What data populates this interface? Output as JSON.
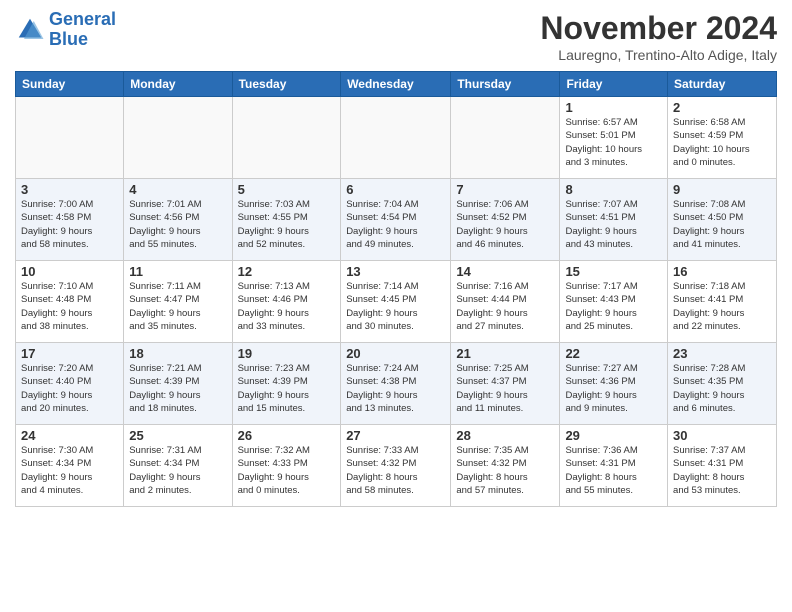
{
  "header": {
    "logo_line1": "General",
    "logo_line2": "Blue",
    "month_title": "November 2024",
    "location": "Lauregno, Trentino-Alto Adige, Italy"
  },
  "weekdays": [
    "Sunday",
    "Monday",
    "Tuesday",
    "Wednesday",
    "Thursday",
    "Friday",
    "Saturday"
  ],
  "weeks": [
    [
      {
        "day": "",
        "info": ""
      },
      {
        "day": "",
        "info": ""
      },
      {
        "day": "",
        "info": ""
      },
      {
        "day": "",
        "info": ""
      },
      {
        "day": "",
        "info": ""
      },
      {
        "day": "1",
        "info": "Sunrise: 6:57 AM\nSunset: 5:01 PM\nDaylight: 10 hours\nand 3 minutes."
      },
      {
        "day": "2",
        "info": "Sunrise: 6:58 AM\nSunset: 4:59 PM\nDaylight: 10 hours\nand 0 minutes."
      }
    ],
    [
      {
        "day": "3",
        "info": "Sunrise: 7:00 AM\nSunset: 4:58 PM\nDaylight: 9 hours\nand 58 minutes."
      },
      {
        "day": "4",
        "info": "Sunrise: 7:01 AM\nSunset: 4:56 PM\nDaylight: 9 hours\nand 55 minutes."
      },
      {
        "day": "5",
        "info": "Sunrise: 7:03 AM\nSunset: 4:55 PM\nDaylight: 9 hours\nand 52 minutes."
      },
      {
        "day": "6",
        "info": "Sunrise: 7:04 AM\nSunset: 4:54 PM\nDaylight: 9 hours\nand 49 minutes."
      },
      {
        "day": "7",
        "info": "Sunrise: 7:06 AM\nSunset: 4:52 PM\nDaylight: 9 hours\nand 46 minutes."
      },
      {
        "day": "8",
        "info": "Sunrise: 7:07 AM\nSunset: 4:51 PM\nDaylight: 9 hours\nand 43 minutes."
      },
      {
        "day": "9",
        "info": "Sunrise: 7:08 AM\nSunset: 4:50 PM\nDaylight: 9 hours\nand 41 minutes."
      }
    ],
    [
      {
        "day": "10",
        "info": "Sunrise: 7:10 AM\nSunset: 4:48 PM\nDaylight: 9 hours\nand 38 minutes."
      },
      {
        "day": "11",
        "info": "Sunrise: 7:11 AM\nSunset: 4:47 PM\nDaylight: 9 hours\nand 35 minutes."
      },
      {
        "day": "12",
        "info": "Sunrise: 7:13 AM\nSunset: 4:46 PM\nDaylight: 9 hours\nand 33 minutes."
      },
      {
        "day": "13",
        "info": "Sunrise: 7:14 AM\nSunset: 4:45 PM\nDaylight: 9 hours\nand 30 minutes."
      },
      {
        "day": "14",
        "info": "Sunrise: 7:16 AM\nSunset: 4:44 PM\nDaylight: 9 hours\nand 27 minutes."
      },
      {
        "day": "15",
        "info": "Sunrise: 7:17 AM\nSunset: 4:43 PM\nDaylight: 9 hours\nand 25 minutes."
      },
      {
        "day": "16",
        "info": "Sunrise: 7:18 AM\nSunset: 4:41 PM\nDaylight: 9 hours\nand 22 minutes."
      }
    ],
    [
      {
        "day": "17",
        "info": "Sunrise: 7:20 AM\nSunset: 4:40 PM\nDaylight: 9 hours\nand 20 minutes."
      },
      {
        "day": "18",
        "info": "Sunrise: 7:21 AM\nSunset: 4:39 PM\nDaylight: 9 hours\nand 18 minutes."
      },
      {
        "day": "19",
        "info": "Sunrise: 7:23 AM\nSunset: 4:39 PM\nDaylight: 9 hours\nand 15 minutes."
      },
      {
        "day": "20",
        "info": "Sunrise: 7:24 AM\nSunset: 4:38 PM\nDaylight: 9 hours\nand 13 minutes."
      },
      {
        "day": "21",
        "info": "Sunrise: 7:25 AM\nSunset: 4:37 PM\nDaylight: 9 hours\nand 11 minutes."
      },
      {
        "day": "22",
        "info": "Sunrise: 7:27 AM\nSunset: 4:36 PM\nDaylight: 9 hours\nand 9 minutes."
      },
      {
        "day": "23",
        "info": "Sunrise: 7:28 AM\nSunset: 4:35 PM\nDaylight: 9 hours\nand 6 minutes."
      }
    ],
    [
      {
        "day": "24",
        "info": "Sunrise: 7:30 AM\nSunset: 4:34 PM\nDaylight: 9 hours\nand 4 minutes."
      },
      {
        "day": "25",
        "info": "Sunrise: 7:31 AM\nSunset: 4:34 PM\nDaylight: 9 hours\nand 2 minutes."
      },
      {
        "day": "26",
        "info": "Sunrise: 7:32 AM\nSunset: 4:33 PM\nDaylight: 9 hours\nand 0 minutes."
      },
      {
        "day": "27",
        "info": "Sunrise: 7:33 AM\nSunset: 4:32 PM\nDaylight: 8 hours\nand 58 minutes."
      },
      {
        "day": "28",
        "info": "Sunrise: 7:35 AM\nSunset: 4:32 PM\nDaylight: 8 hours\nand 57 minutes."
      },
      {
        "day": "29",
        "info": "Sunrise: 7:36 AM\nSunset: 4:31 PM\nDaylight: 8 hours\nand 55 minutes."
      },
      {
        "day": "30",
        "info": "Sunrise: 7:37 AM\nSunset: 4:31 PM\nDaylight: 8 hours\nand 53 minutes."
      }
    ]
  ]
}
